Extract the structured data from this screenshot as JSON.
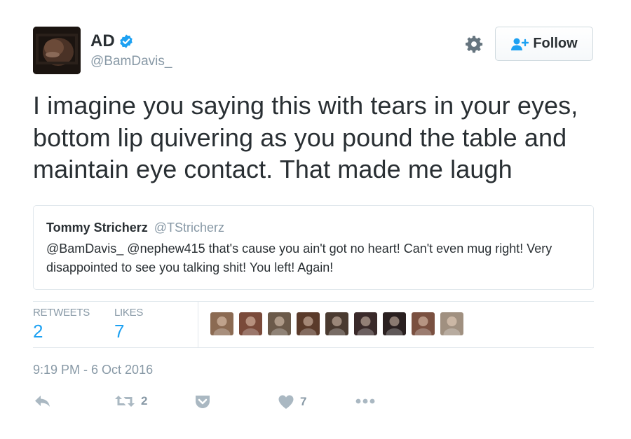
{
  "tweet": {
    "author": {
      "name": "AD",
      "handle": "@BamDavis_",
      "verified": true
    },
    "follow_label": "Follow",
    "text": "I imagine you saying this with tears in your eyes, bottom lip quivering as you pound the table and maintain eye contact. That made me laugh",
    "quoted": {
      "name": "Tommy Stricherz",
      "handle": "@TStricherz",
      "text": "@BamDavis_ @nephew415 that's cause you ain't got no heart! Can't even mug right! Very disappointed to see you talking shit! You left! Again!"
    },
    "stats": {
      "retweets_label": "RETWEETS",
      "retweets_value": "2",
      "likes_label": "LIKES",
      "likes_value": "7"
    },
    "likers": [
      {
        "icon": "liker-avatar-1",
        "color": "#8b6a52"
      },
      {
        "icon": "liker-avatar-2",
        "color": "#7a4a3a"
      },
      {
        "icon": "liker-avatar-3",
        "color": "#6b5a4a"
      },
      {
        "icon": "liker-avatar-4",
        "color": "#5a3a2a"
      },
      {
        "icon": "liker-avatar-5",
        "color": "#4a3a30"
      },
      {
        "icon": "liker-avatar-6",
        "color": "#3a2a2a"
      },
      {
        "icon": "liker-avatar-7",
        "color": "#2a2020"
      },
      {
        "icon": "liker-avatar-8",
        "color": "#7a5040"
      },
      {
        "icon": "liker-avatar-9",
        "color": "#a09080"
      }
    ],
    "timestamp": "9:19 PM - 6 Oct 2016",
    "actions": {
      "retweet_count": "2",
      "like_count": "7"
    }
  },
  "colors": {
    "accent": "#1da1f2",
    "text": "#292f33",
    "muted": "#8899a6",
    "border": "#e1e8ed",
    "icon": "#aab8c2"
  }
}
